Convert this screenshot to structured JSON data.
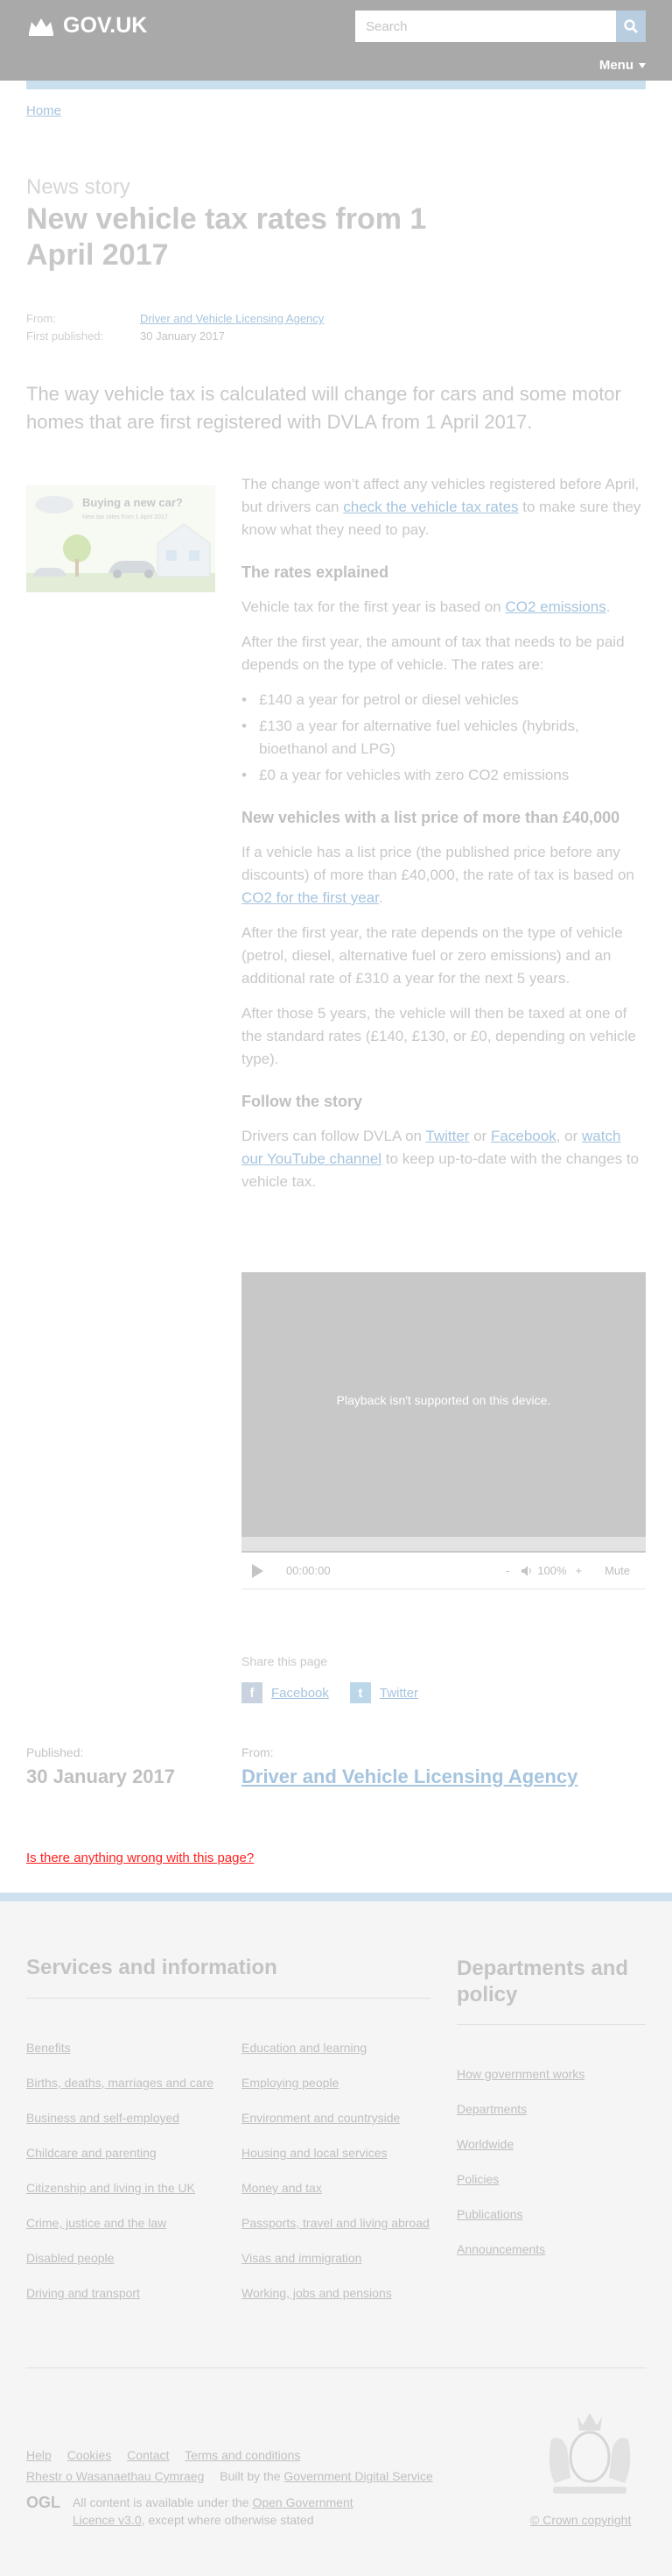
{
  "header": {
    "logo_text": "GOV.UK",
    "search_placeholder": "Search",
    "menu_label": "Menu"
  },
  "breadcrumb": {
    "home": "Home"
  },
  "article": {
    "kicker": "News story",
    "title": "New vehicle tax rates from 1 April 2017",
    "meta": {
      "from_label": "From:",
      "from_value": "Driver and Vehicle Licensing Agency",
      "published_label": "First published:",
      "published_value": "30 January 2017"
    },
    "lead": "The way vehicle tax is calculated will change for cars and some motor homes that are first registered with DVLA from 1 April 2017.",
    "illustration": {
      "heading": "Buying a new car?",
      "sub": "New tax rates from 1 April 2017"
    },
    "p1_before": "The change won’t affect any vehicles registered before April, but drivers can ",
    "p1_link": "check the vehicle tax rates",
    "p1_after": " to make sure they know what they need to pay.",
    "h_rates": "The rates explained",
    "p2_before": "Vehicle tax for the first year is based on ",
    "p2_link": "CO2 emissions",
    "p2_after": ".",
    "p3": "After the first year, the amount of tax that needs to be paid depends on the type of vehicle. The rates are:",
    "rates": [
      "£140 a year for petrol or diesel vehicles",
      "£130 a year for alternative fuel vehicles (hybrids, bioethanol and LPG)",
      "£0 a year for vehicles with zero CO2 emissions"
    ],
    "h_list": "New vehicles with a list price of more than £40,000",
    "p4_before": "If a vehicle has a list price (the published price before any discounts) of more than £40,000, the rate of tax is based on ",
    "p4_link": "CO2 for the first year",
    "p4_after": ".",
    "p5": "After the first year, the rate depends on the type of vehicle (petrol, diesel, alternative fuel or zero emissions) and an additional rate of £310 a year for the next 5 years.",
    "p6": "After those 5 years, the vehicle will then be taxed at one of the standard rates (£140, £130, or £0, depending on vehicle type).",
    "h_follow": "Follow the story",
    "p7_before": "Drivers can follow DVLA on ",
    "p7_link1": "Twitter",
    "p7_mid1": " or ",
    "p7_link2": "Facebook",
    "p7_mid2": ", or ",
    "p7_link3": "watch our YouTube channel",
    "p7_after": " to keep up-to-date with the changes to vehicle tax."
  },
  "video": {
    "message": "Playback isn't supported on this device.",
    "time": "00:00:00",
    "minus": "-",
    "volume": "100%",
    "plus": "+",
    "mute": "Mute"
  },
  "share": {
    "label": "Share this page",
    "facebook": "Facebook",
    "twitter": "Twitter",
    "facebook_glyph": "f",
    "twitter_glyph": "t"
  },
  "published_block": {
    "published_label": "Published:",
    "published_value": "30 January 2017",
    "from_label": "From:",
    "from_value": "Driver and Vehicle Licensing Agency"
  },
  "report_link": "Is there anything wrong with this page?",
  "footer": {
    "services_heading": "Services and information",
    "departments_heading": "Departments and policy",
    "services_col1": [
      "Benefits",
      "Births, deaths, marriages and care",
      "Business and self-employed",
      "Childcare and parenting",
      "Citizenship and living in the UK",
      "Crime, justice and the law",
      "Disabled people",
      "Driving and transport"
    ],
    "services_col2": [
      "Education and learning",
      "Employing people",
      "Environment and countryside",
      "Housing and local services",
      "Money and tax",
      "Passports, travel and living abroad",
      "Visas and immigration",
      "Working, jobs and pensions"
    ],
    "departments": [
      "How government works",
      "Departments",
      "Worldwide",
      "Policies",
      "Publications",
      "Announcements"
    ],
    "links": {
      "help": "Help",
      "cookies": "Cookies",
      "contact": "Contact",
      "terms": "Terms and conditions",
      "welsh": "Rhestr o Wasanaethau Cymraeg",
      "built_by": "Built by the ",
      "gds": "Government Digital Service"
    },
    "ogl_mark": "OGL",
    "licence_before": "All content is available under the ",
    "licence_link": "Open Government Licence v3.0",
    "licence_after": ", except where otherwise stated",
    "copyright": "© Crown copyright"
  },
  "colors": {
    "header_bg": "#a9a9a9",
    "link": "#a6c4de",
    "footer_bg": "#f5f5f5",
    "report_link": "#ff2020"
  },
  "icons": [
    "crown-logo-icon",
    "search-icon",
    "menu-triangle-icon",
    "play-icon",
    "volume-icon",
    "facebook-icon",
    "twitter-icon",
    "royal-crest-icon"
  ]
}
